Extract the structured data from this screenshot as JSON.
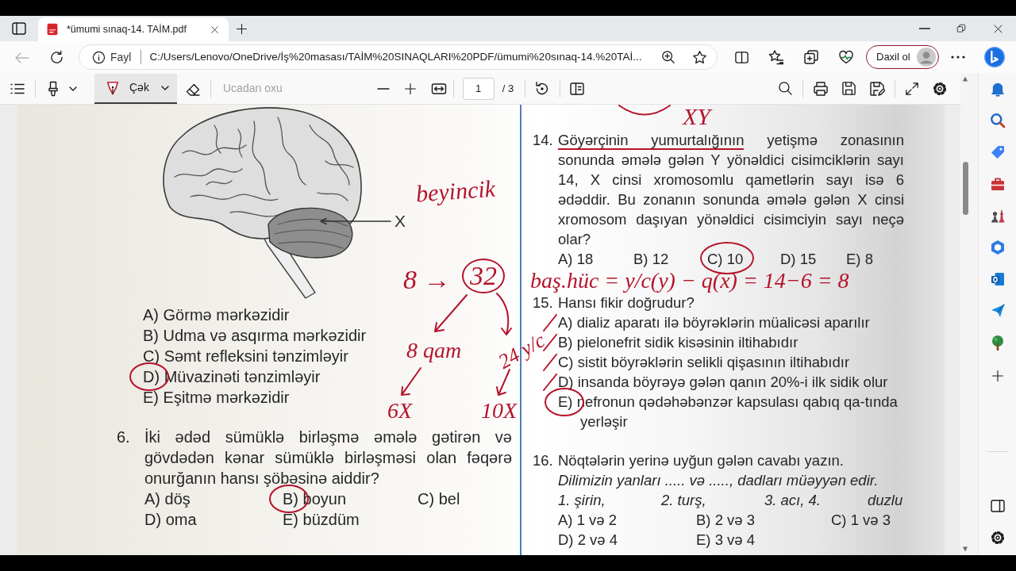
{
  "browser": {
    "tabs": [
      {
        "title": "*ümumi sınaq-14. TAİM.pdf",
        "selected": true
      }
    ],
    "address": {
      "site_label": "Fayl",
      "url": "C:/Users/Lenovo/OneDrive/İş%20masası/TAİM%20SINAQLARI%20PDF/ümumi%20sınaq-14.%20TAİ..."
    },
    "sign_in": "Daxil ol"
  },
  "pdf_toolbar": {
    "draw_tool": {
      "label": "Çək",
      "selected": true
    },
    "read_aloud": {
      "label": "Ucadan oxu",
      "disabled": true
    },
    "page": "1",
    "page_total": "/ 3"
  },
  "document": {
    "left_column": {
      "figure": {
        "label": "X"
      },
      "options": [
        {
          "text": "A) Görmə mərkəzidir",
          "circled": false
        },
        {
          "text": "B) Udma və asqırma mərkəzidir",
          "circled": false
        },
        {
          "text": "C) Səmt refleksini tənzimləyir",
          "circled": false
        },
        {
          "text": "D) Müvazinəti tənzimləyir",
          "circled": true
        },
        {
          "text": "E) Eşitmə mərkəzidir",
          "circled": false
        }
      ],
      "questions": [
        {
          "number": "6.",
          "kind": "grid",
          "text": "İki ədəd sümüklə birləşmə əmələ gətirən və gövdədən kənar sümüklə birləşməsi olan fəqərə onurğanın hansı şöbəsinə aiddir?",
          "options": [
            {
              "text": "A) döş",
              "circled": false
            },
            {
              "text": "B) boyun",
              "circled": true
            },
            {
              "text": "C) bel",
              "circled": false
            },
            {
              "text": "D) oma",
              "circled": false
            },
            {
              "text": "E) büzdüm",
              "circled": false
            }
          ]
        }
      ]
    },
    "right_column": {
      "questions": [
        {
          "number": "14.",
          "kind": "row",
          "lead": "Göyərçinin yumurtalığının",
          "lead_underlined": true,
          "text": "yetişmə zonasının sonunda əmələ gələn Y yönəldici cisimciklərin sayı 14, X cinsi xromosomlu qametlərin sayı isə 6 ədəddir. Bu zonanın sonunda əmələ gələn X cinsi xromosom daşıyan yönəldici cisimciyin sayı neçə olar?",
          "options": [
            {
              "text": "A) 18",
              "circled": false
            },
            {
              "text": "B) 12",
              "circled": false
            },
            {
              "text": "C) 10",
              "circled": true
            },
            {
              "text": "D) 15",
              "circled": false
            },
            {
              "text": "E) 8",
              "circled": false
            }
          ]
        },
        {
          "number": "15.",
          "kind": "list",
          "text": "Hansı fikir doğrudur?",
          "options": [
            {
              "text": "A) dializ aparatı ilə böyrəklərin müalicəsi aparılır",
              "circled": false,
              "crossed": true
            },
            {
              "text": "B) pielonefrit sidik kisəsinin iltihabıdır",
              "circled": false,
              "crossed": true
            },
            {
              "text": "C) sistit böyrəklərin selikli qişasının iltihabıdır",
              "circled": false,
              "crossed": true
            },
            {
              "text": "D) insanda böyrəyə gələn qanın 20%-i ilk sidik olur",
              "circled": false,
              "crossed": true
            },
            {
              "text": "E) nefronun qədəhəbənzər kapsulası qabıq qa-tında yerləşir",
              "circled": true,
              "crossed": false
            }
          ]
        },
        {
          "number": "16.",
          "kind": "grid",
          "text": "Nöqtələrin yerinə uyğun gələn cavabı yazın.",
          "prompt": "Dilimizin yanları ..... və ....., dadları müəyyən edir.",
          "items": [
            "1. şirin,",
            "2. turş,",
            "3. acı, 4.",
            "duzlu"
          ],
          "options": [
            {
              "text": "A) 1 və 2",
              "circled": false
            },
            {
              "text": "B) 2 və 3",
              "circled": false
            },
            {
              "text": "C) 1 və 3",
              "circled": false
            },
            {
              "text": "D) 2 və 4",
              "circled": false
            },
            {
              "text": "E) 3 və 4",
              "circled": false
            }
          ]
        }
      ]
    },
    "notes": [
      {
        "text": "beyincik",
        "circled": false
      },
      {
        "text": "8 →",
        "circled": false
      },
      {
        "text": "32",
        "circled": true
      },
      {
        "text": "8 qam",
        "circled": false
      },
      {
        "text": "24 y/c",
        "circled": false
      },
      {
        "text": "6X",
        "circled": false
      },
      {
        "text": "10X",
        "circled": false
      },
      {
        "text": "XY",
        "circled": false
      },
      {
        "text": "baş.hüc = y/c(y) − q(x) = 14−6 = 8",
        "circled": false
      }
    ]
  }
}
